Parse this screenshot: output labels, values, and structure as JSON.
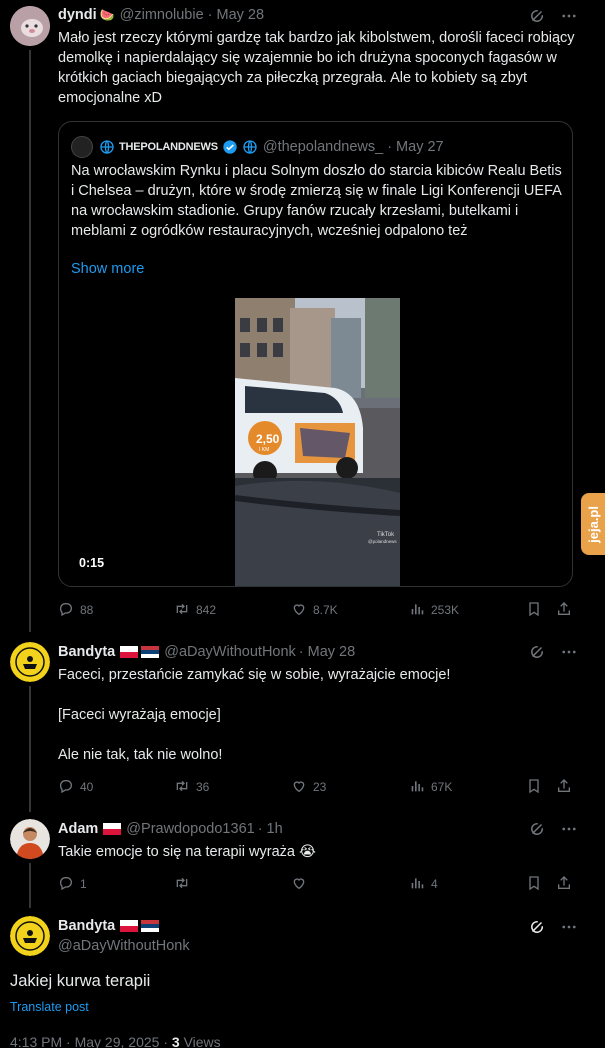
{
  "posts": [
    {
      "name": "dyndi",
      "emoji": "🍉",
      "handle": "@zimnolubie",
      "dot": "·",
      "date": "May 28",
      "text": "Mało jest rzeczy którymi gardzę tak bardzo jak kibolstwem, dorośli faceci robiący demolkę i napierdalający się wzajemnie bo ich drużyna spoconych fagasów w krótkich gaciach biegających za piłeczką przegrała. Ale to kobiety są zbyt emocjonalne xD",
      "quote": {
        "name": "THEPOLANDNEWS",
        "handle": "@thepolandnews_",
        "dot": "·",
        "date": "May 27",
        "text": "Na wrocławskim Rynku i placu Solnym doszło do starcia kibiców Realu Betis i Chelsea – drużyn, które w środę zmierzą się w finale Ligi Konferencji UEFA na wrocławskim stadionie. Grupy fanów rzucały krzesłami, butelkami i meblami z ogródków restauracyjnych, wcześniej odpalono też",
        "show_more": "Show more",
        "duration": "0:15",
        "car_text": "2,50",
        "car_unit": "I KM",
        "tiktok_label": "TikTok",
        "tiktok_user": "@polandnews"
      },
      "stats": {
        "replies": "88",
        "reposts": "842",
        "likes": "8.7K",
        "views": "253K"
      }
    },
    {
      "name": "Bandyta",
      "handle": "@aDayWithoutHonk",
      "dot": "·",
      "date": "May 28",
      "lines": [
        "Faceci, przestańcie zamykać się w sobie, wyrażajcie emocje!",
        "[Faceci wyrażają emocje]",
        "Ale nie tak, tak nie wolno!"
      ],
      "stats": {
        "replies": "40",
        "reposts": "36",
        "likes": "23",
        "views": "67K"
      }
    },
    {
      "name": "Adam",
      "handle": "@Prawdopodo1361",
      "dot": "·",
      "date": "1h",
      "text": "Takie emocje to się na terapii wyraża",
      "emoji": "😭",
      "stats": {
        "replies": "1",
        "reposts": "",
        "likes": "",
        "views": "4"
      }
    }
  ],
  "main": {
    "name": "Bandyta",
    "handle": "@aDayWithoutHonk",
    "text": "Jakiej kurwa terapii",
    "translate": "Translate post",
    "time": "4:13 PM",
    "dot": "·",
    "date": "May 29, 2025",
    "dot2": "·",
    "views": "3",
    "views_label": "Views"
  },
  "side_tab": "jeja.pl",
  "colors": {
    "background": "#000000",
    "text": "#e7e9ea",
    "muted": "#71767b",
    "link": "#1d9bf0",
    "border": "#2f3336",
    "tab": "#e9a24a"
  }
}
